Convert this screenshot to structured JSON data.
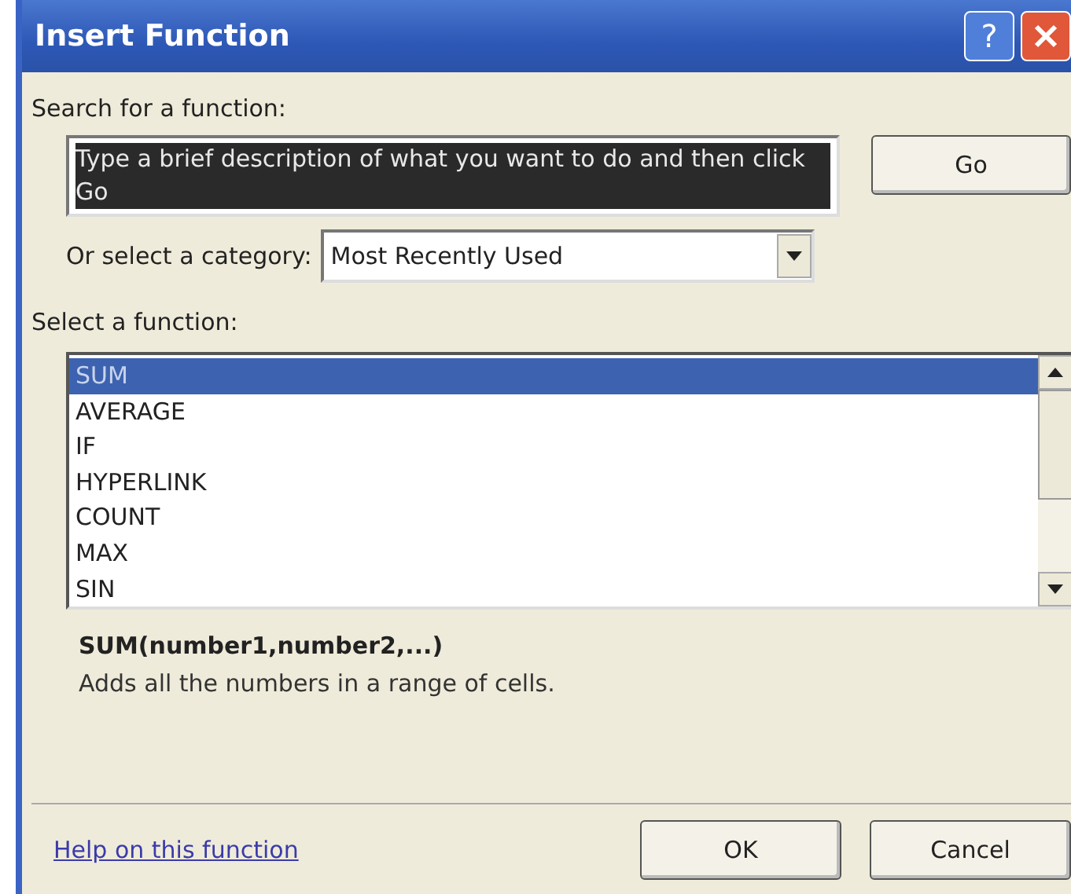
{
  "window": {
    "title": "Insert Function",
    "help_button": "?"
  },
  "search": {
    "label": "Search for a function:",
    "value": "Type a brief description of what you want to do and then click Go",
    "text_selected": true,
    "go_button": "Go"
  },
  "category": {
    "label": "Or select a category:",
    "value": "Most Recently Used"
  },
  "functions": {
    "label": "Select a function:",
    "items": [
      {
        "name": "SUM",
        "selected": true
      },
      {
        "name": "AVERAGE",
        "selected": false
      },
      {
        "name": "IF",
        "selected": false
      },
      {
        "name": "HYPERLINK",
        "selected": false
      },
      {
        "name": "COUNT",
        "selected": false
      },
      {
        "name": "MAX",
        "selected": false
      },
      {
        "name": "SIN",
        "selected": false
      }
    ]
  },
  "signature": "SUM(number1,number2,...)",
  "description": "Adds all the numbers in a range of cells.",
  "help_link": "Help on this function",
  "buttons": [
    "OK",
    "Cancel"
  ]
}
